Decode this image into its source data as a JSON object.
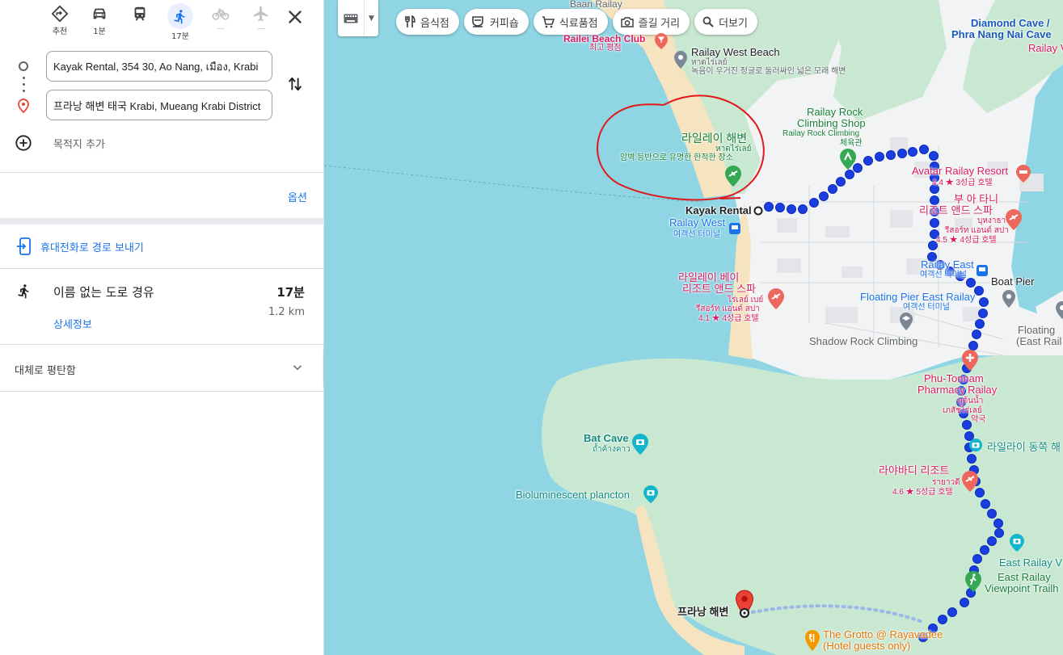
{
  "modes": [
    {
      "name": "recommended",
      "label": "추천"
    },
    {
      "name": "drive",
      "label": "1분"
    },
    {
      "name": "transit",
      "label": ""
    },
    {
      "name": "walk",
      "label": "17분"
    },
    {
      "name": "bike",
      "label": "—"
    },
    {
      "name": "flight",
      "label": "—"
    }
  ],
  "directions": {
    "origin_value": "Kayak Rental, 354 30, Ao Nang, เมือง, Krabi",
    "destination_value": "프라낭 해변 태국 Krabi, Mueang Krabi District",
    "add_destination": "목적지 추가",
    "options": "옵션",
    "send_to_phone": "휴대전화로 경로 보내기"
  },
  "route": {
    "name": "이름 없는 도로 경유",
    "time": "17분",
    "distance": "1.2 km",
    "details": "상세정보",
    "terrain": "대체로 평탄함"
  },
  "map": {
    "chips": [
      "음식점",
      "커피숍",
      "식료품점",
      "즐길 거리",
      "더보기"
    ],
    "labels": {
      "baan_railay": "Baan Railay",
      "railei_beach_club": "Railei Beach Club",
      "best_rated": "최고 평점",
      "railay_west_beach": "Railay West Beach",
      "railay_west_beach_th": "หาดไร่เลย์",
      "railay_west_beach_desc": "녹음이 우거진 정글로 둘러싸인 넓은 모래 해변",
      "diamond_cave": "Diamond Cave /",
      "phra_nang_nai_cave": "Phra Nang Nai Cave",
      "railay_v": "Railay V",
      "railay_rock_climbing_shop": "Railay Rock",
      "railay_rock_climbing_shop_2": "Climbing Shop",
      "railay_rock_climbing": "Railay Rock Climbing",
      "gym": "체육관",
      "railay_beach_ko": "라일레이 해변",
      "railay_beach_th": "หาดไร่เลย์",
      "railay_beach_desc": "암벽 등반으로 유명한 한적한 장소",
      "avatar_resort": "Avatar Railay Resort",
      "avatar_rating": "4.4 ★ 3성급 호텔",
      "bua_tani_1": "부 아 타니",
      "bua_tani_2": "리조트 앤드 스파",
      "bua_tani_th_1": "บุหงาธานี",
      "bua_tani_th_2": "รีสอร์ท แอนด์ สปา",
      "bua_tani_rating": "4.5 ★ 4성급 호텔",
      "kayak_rental": "Kayak Rental",
      "railay_west_pier": "Railay West",
      "railay_west_pier_ko": "여객선 터미널",
      "railay_east_pier": "Railay East",
      "railay_east_pier_ko": "여객선 터미널",
      "boat_pier": "Boat Pier",
      "railay_bay_1": "라일레이 베이",
      "railay_bay_2": "리조트 앤드 스파",
      "railay_bay_th_1": "ไร่เลย์ เบย์",
      "railay_bay_th_2": "รีสอร์ท แอนด์ สปา",
      "railay_bay_rating": "4.1 ★ 4성급 호텔",
      "floating_pier_east": "Floating Pier East Railay",
      "floating_pier_east_ko": "여객선 터미널",
      "floating_2": "Floating",
      "floating_2b": "(East Rail",
      "shadow_rock": "Shadow Rock Climbing",
      "phu_tonnam_1": "Phu-Tonnam",
      "phu_tonnam_2": "Pharmacy Railay",
      "phu_tonnam_th_1": "ภูต้นน้ำ",
      "phu_tonnam_th_2": "เภสัชไร่เลย์",
      "phu_tonnam_ko": "약국",
      "railay_east_cave": "라일라이 동쪽 해",
      "bat_cave": "Bat Cave",
      "bat_cave_th": "ถ้ำค้างคาว",
      "rayavadee": "라야바디 리조트",
      "rayavadee_th": "รายาวดี",
      "rayavadee_rating": "4.6 ★ 5성급 호텔",
      "bioluminescent": "Bioluminescent plancton",
      "east_railay_v": "East Railay V",
      "east_railay_viewpoint_1": "East Railay",
      "east_railay_viewpoint_2": "Viewpoint Trailh",
      "phra_nang_beach": "프라낭 해변",
      "grotto_1": "The Grotto @ Rayavadee",
      "grotto_2": "(Hotel guests only)"
    }
  },
  "colors": {
    "water": "#8fd5e3",
    "land": "#f1f3f4",
    "park": "#c9e8d2",
    "sand": "#f5e4bf",
    "route": "#1a3de0",
    "annotation": "#e2181b",
    "accent": "#1a73e8"
  }
}
